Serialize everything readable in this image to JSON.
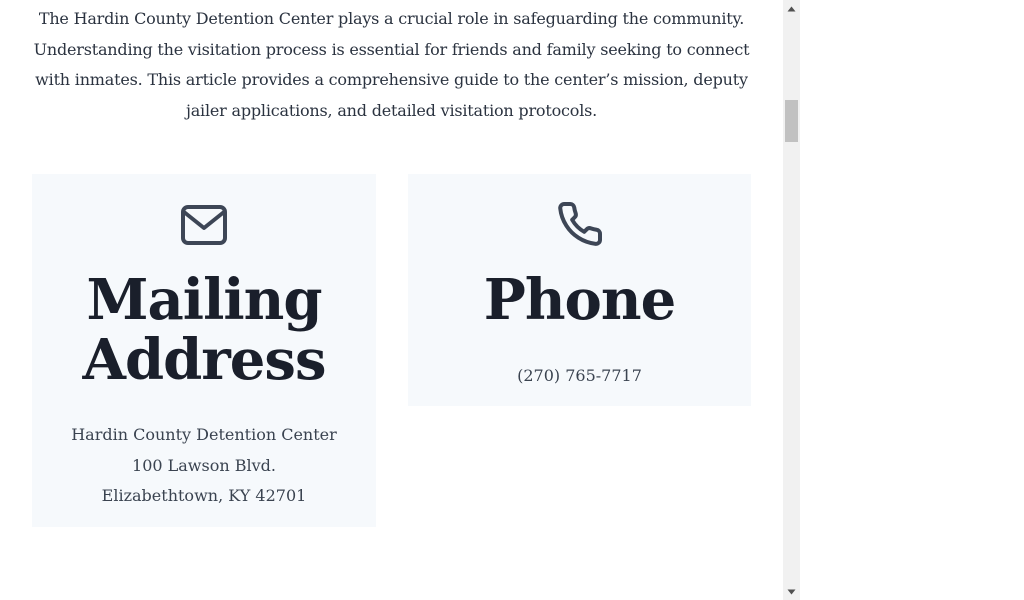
{
  "intro": {
    "text": "The Hardin County Detention Center plays a crucial role in safeguarding the community. Understanding the visitation process is essential for friends and family seeking to connect with inmates. This article provides a comprehensive guide to the center’s mission, deputy jailer applications, and detailed visitation protocols."
  },
  "cards": {
    "mailing": {
      "icon": "envelope-icon",
      "title_line1": "Mailing",
      "title_line2": "Address",
      "lines": [
        "Hardin County Detention Center",
        "100 Lawson Blvd.",
        "Elizabethtown, KY 42701"
      ]
    },
    "phone": {
      "icon": "phone-icon",
      "title": "Phone",
      "number": "(270) 765-7717"
    }
  },
  "colors": {
    "card_background": "#f6f9fc",
    "heading": "#1a1f2b",
    "body_text": "#2b3340",
    "icon": "#3d4656",
    "scrollbar_track": "#f1f1f1",
    "scrollbar_thumb": "#c1c1c1"
  }
}
